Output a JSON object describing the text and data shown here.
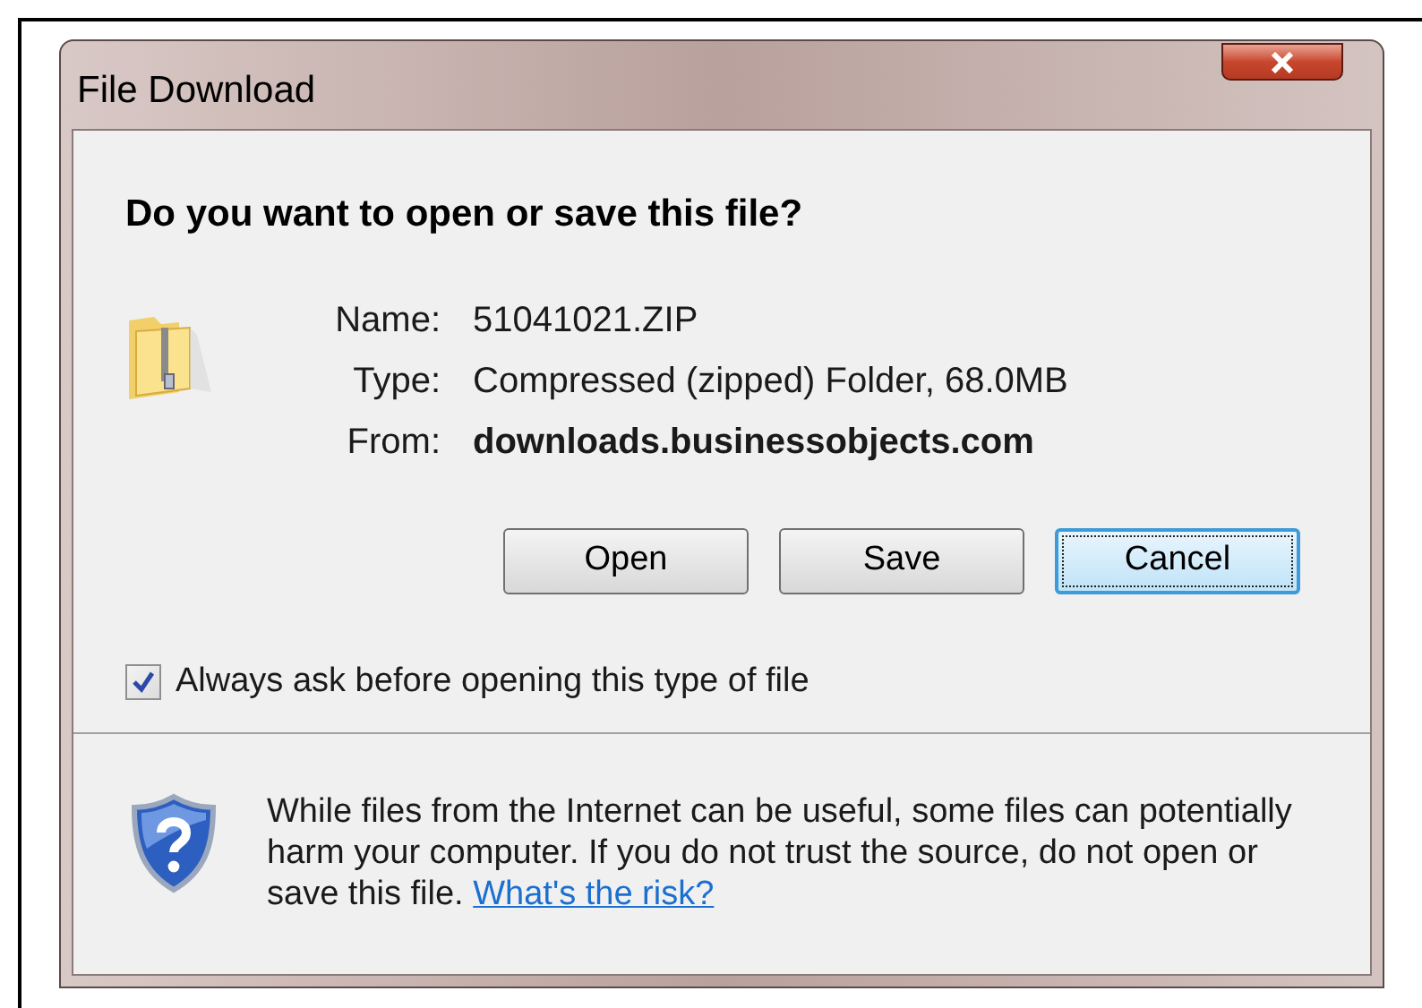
{
  "window": {
    "title": "File Download"
  },
  "heading": "Do you want to open or save this file?",
  "fields": [
    {
      "label": "Name:",
      "value": "51041021.ZIP",
      "bold": false
    },
    {
      "label": "Type:",
      "value": "Compressed (zipped) Folder, 68.0MB",
      "bold": false
    },
    {
      "label": "From:",
      "value": "downloads.businessobjects.com",
      "bold": true
    }
  ],
  "buttons": [
    {
      "label": "Open",
      "focused": false
    },
    {
      "label": "Save",
      "focused": false
    },
    {
      "label": "Cancel",
      "focused": true
    }
  ],
  "checkbox": {
    "label": "Always ask before opening this type of file",
    "checked": true
  },
  "warning": {
    "text": "While files from the Internet can be useful, some files can potentially harm your computer. If you do not trust the source, do not open or save this file.",
    "link": "What's the risk?"
  }
}
